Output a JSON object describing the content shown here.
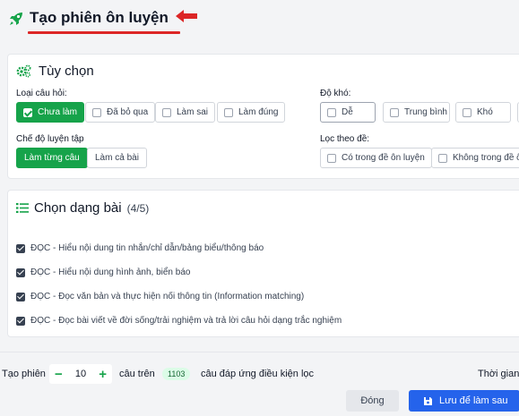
{
  "header": {
    "title": "Tạo phiên ôn luyện"
  },
  "options": {
    "title": "Tùy chọn",
    "question_type_label": "Loại câu hỏi:",
    "question_types": [
      "Chưa làm",
      "Đã bỏ qua",
      "Làm sai",
      "Làm đúng"
    ],
    "question_type_selected": "Chưa làm",
    "difficulty_label": "Độ khó:",
    "difficulties": [
      "Dễ",
      "Trung bình",
      "Khó"
    ],
    "mode_label": "Chế độ luyện tập",
    "modes": [
      "Làm từng câu",
      "Làm cả bài"
    ],
    "mode_selected": "Làm từng câu",
    "exam_filter_label": "Lọc theo đề:",
    "exam_filters": [
      "Có trong đề ôn luyện",
      "Không trong đề ôn"
    ]
  },
  "types": {
    "title": "Chọn dạng bài",
    "count": "(4/5)",
    "items": [
      "ĐỌC - Hiểu nội dung tin nhắn/chỉ dẫn/bảng biểu/thông báo",
      "ĐỌC - Hiểu nội dung hình ảnh, biển báo",
      "ĐỌC - Đọc văn bản và thực hiện nối thông tin (Information matching)",
      "ĐỌC - Đọc bài viết về đời sống/trải nghiệm và trả lời câu hỏi dạng trắc nghiệm"
    ]
  },
  "footer": {
    "create_label": "Tạo phiên",
    "count_value": "10",
    "minus": "−",
    "plus": "+",
    "questions_on": "câu trên",
    "available_count": "1103",
    "matching_text": "câu đáp ứng điều kiện lọc",
    "time_label": "Thời gian",
    "close_label": "Đóng",
    "save_label": "Lưu để làm sau"
  },
  "colors": {
    "accent_green": "#16a34a",
    "primary_blue": "#2563eb",
    "title_underline_red": "#dc2626"
  }
}
